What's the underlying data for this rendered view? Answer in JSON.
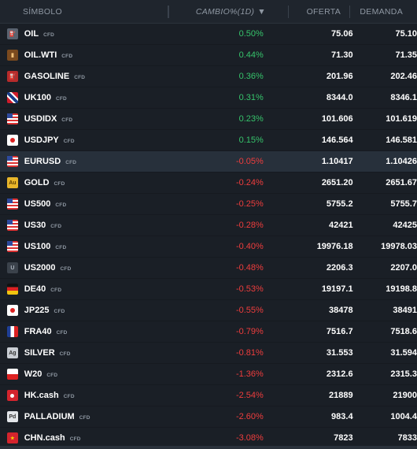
{
  "header": {
    "symbol": "SÍMBOLO",
    "change": "CAMBIO%(1D)",
    "sort_arrow": "▼",
    "bid": "OFERTA",
    "ask": "DEMANDA"
  },
  "colors": {
    "positive": "#36c46b",
    "negative": "#ef3d3d",
    "background": "#1a1f26",
    "selected_row": "#27303b"
  },
  "rows": [
    {
      "icon": "oil-icon",
      "symbol": "OIL",
      "tag": "CFD",
      "change": "0.50%",
      "bid": "75.06",
      "ask": "75.10",
      "dir": "pos"
    },
    {
      "icon": "oil-barrel-icon",
      "symbol": "OIL.WTI",
      "tag": "CFD",
      "change": "0.44%",
      "bid": "71.30",
      "ask": "71.35",
      "dir": "pos"
    },
    {
      "icon": "gasoline-icon",
      "symbol": "GASOLINE",
      "tag": "CFD",
      "change": "0.36%",
      "bid": "201.96",
      "ask": "202.46",
      "dir": "pos"
    },
    {
      "icon": "uk-flag-icon",
      "symbol": "UK100",
      "tag": "CFD",
      "change": "0.31%",
      "bid": "8344.0",
      "ask": "8346.1",
      "dir": "pos"
    },
    {
      "icon": "us-flag-icon",
      "symbol": "USDIDX",
      "tag": "CFD",
      "change": "0.23%",
      "bid": "101.606",
      "ask": "101.619",
      "dir": "pos"
    },
    {
      "icon": "jp-flag-icon",
      "symbol": "USDJPY",
      "tag": "CFD",
      "change": "0.15%",
      "bid": "146.564",
      "ask": "146.581",
      "dir": "pos"
    },
    {
      "icon": "eu-us-flag-icon",
      "symbol": "EURUSD",
      "tag": "CFD",
      "change": "-0.05%",
      "bid": "1.10417",
      "ask": "1.10426",
      "dir": "neg",
      "selected": true
    },
    {
      "icon": "gold-icon",
      "symbol": "GOLD",
      "tag": "CFD",
      "change": "-0.24%",
      "bid": "2651.20",
      "ask": "2651.67",
      "dir": "neg"
    },
    {
      "icon": "us-flag-icon",
      "symbol": "US500",
      "tag": "CFD",
      "change": "-0.25%",
      "bid": "5755.2",
      "ask": "5755.7",
      "dir": "neg"
    },
    {
      "icon": "us-flag-icon",
      "symbol": "US30",
      "tag": "CFD",
      "change": "-0.28%",
      "bid": "42421",
      "ask": "42425",
      "dir": "neg"
    },
    {
      "icon": "us-flag-icon",
      "symbol": "US100",
      "tag": "CFD",
      "change": "-0.40%",
      "bid": "19976.18",
      "ask": "19978.03",
      "dir": "neg"
    },
    {
      "icon": "u-icon",
      "symbol": "US2000",
      "tag": "CFD",
      "change": "-0.48%",
      "bid": "2206.3",
      "ask": "2207.0",
      "dir": "neg"
    },
    {
      "icon": "de-flag-icon",
      "symbol": "DE40",
      "tag": "CFD",
      "change": "-0.53%",
      "bid": "19197.1",
      "ask": "19198.8",
      "dir": "neg"
    },
    {
      "icon": "jp-flag-icon",
      "symbol": "JP225",
      "tag": "CFD",
      "change": "-0.55%",
      "bid": "38478",
      "ask": "38491",
      "dir": "neg"
    },
    {
      "icon": "fr-flag-icon",
      "symbol": "FRA40",
      "tag": "CFD",
      "change": "-0.79%",
      "bid": "7516.7",
      "ask": "7518.6",
      "dir": "neg"
    },
    {
      "icon": "silver-icon",
      "symbol": "SILVER",
      "tag": "CFD",
      "change": "-0.81%",
      "bid": "31.553",
      "ask": "31.594",
      "dir": "neg"
    },
    {
      "icon": "pl-flag-icon",
      "symbol": "W20",
      "tag": "CFD",
      "change": "-1.36%",
      "bid": "2312.6",
      "ask": "2315.3",
      "dir": "neg"
    },
    {
      "icon": "hk-flag-icon",
      "symbol": "HK.cash",
      "tag": "CFD",
      "change": "-2.54%",
      "bid": "21889",
      "ask": "21900",
      "dir": "neg"
    },
    {
      "icon": "palladium-icon",
      "symbol": "PALLADIUM",
      "tag": "CFD",
      "change": "-2.60%",
      "bid": "983.4",
      "ask": "1004.4",
      "dir": "neg"
    },
    {
      "icon": "cn-flag-icon",
      "symbol": "CHN.cash",
      "tag": "CFD",
      "change": "-3.08%",
      "bid": "7823",
      "ask": "7833",
      "dir": "neg"
    }
  ]
}
